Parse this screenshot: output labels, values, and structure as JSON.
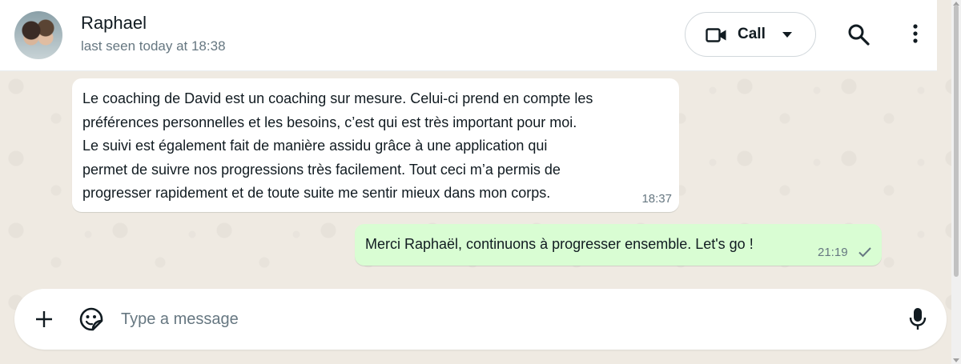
{
  "header": {
    "contact_name": "Raphael",
    "last_seen": "last seen today at 18:38",
    "call_label": "Call",
    "icons": {
      "avatar": "contact-avatar",
      "call": "video-camera-icon",
      "dropdown": "caret-down-icon",
      "search": "search-icon",
      "menu": "kebab-menu-icon"
    }
  },
  "messages": [
    {
      "direction": "incoming",
      "text": "Le coaching de David est un coaching sur mesure. Celui-ci prend en compte les\npréférences personnelles et les besoins, c’est qui est très important pour moi.\nLe suivi est également fait de manière assidu grâce à une application qui\npermet de suivre nos progressions très facilement. Tout ceci m’a permis de\nprogresser rapidement et de toute suite me sentir mieux dans mon corps.",
      "time": "18:37"
    },
    {
      "direction": "outgoing",
      "text": "Merci Raphaël, continuons à progresser ensemble. Let's go !",
      "time": "21:19",
      "status": "sent-single-tick"
    }
  ],
  "composer": {
    "placeholder": "Type a message",
    "value": "",
    "icons": {
      "attach": "plus-icon",
      "sticker": "sticker-icon",
      "voice": "microphone-icon"
    }
  },
  "colors": {
    "chat_background": "#efeae2",
    "incoming_bubble": "#ffffff",
    "outgoing_bubble": "#d9fdd3",
    "secondary_text": "#667781"
  }
}
